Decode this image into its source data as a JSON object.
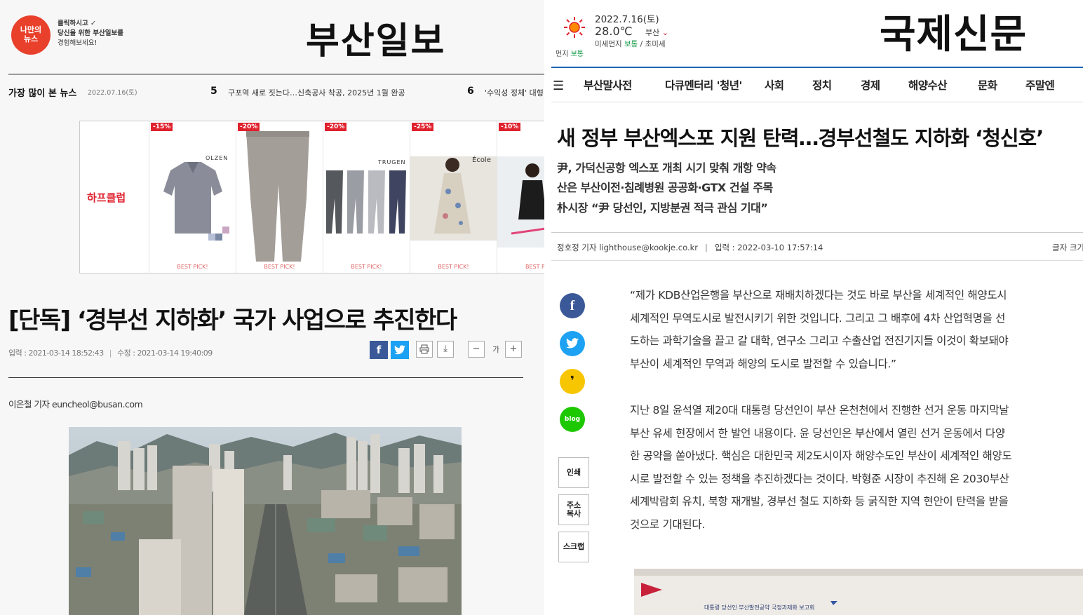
{
  "left": {
    "promo": {
      "circle_text": [
        "나만의",
        "뉴스"
      ],
      "lines": [
        "클릭하시고 ✓",
        "당신을 위한 부산일보를",
        "경험해보세요!"
      ]
    },
    "logo": "부산일보",
    "most_viewed": {
      "label": "가장 많이 본 뉴스",
      "date": "2022.07.16(토)",
      "items": [
        {
          "rank": "5",
          "title": "구포역 새로 짓는다…신축공사 착공, 2025년 1월 완공"
        },
        {
          "rank": "6",
          "title": "'수익성 정체' 대형"
        }
      ]
    },
    "ad": {
      "brand": "하프클럽",
      "items": [
        {
          "badge": "-15%",
          "label": "OLZEN",
          "pick": "BEST PICK!"
        },
        {
          "badge": "-20%",
          "label": "",
          "pick": "BEST PICK!"
        },
        {
          "badge": "-20%",
          "label": "TRUGEN",
          "pick": "BEST PICK!"
        },
        {
          "badge": "-25%",
          "label": "École",
          "pick": "BEST PICK!"
        },
        {
          "badge": "-10%",
          "label": "",
          "pick": "BEST P"
        }
      ]
    },
    "article": {
      "headline": "[단독] ‘경부선 지하화’ 국가 사업으로 추진한다",
      "input_time": "입력 : 2021-03-14 18:52:43",
      "modified_time": "수정 : 2021-03-14 19:40:09",
      "font_label": "가",
      "reporter": "이은철 기자 euncheol@busan.com"
    }
  },
  "right": {
    "weather": {
      "date": "2022.7.16(토)",
      "temp": "28.0℃",
      "city": "부산",
      "dust_label": "미세먼지",
      "dust_value": "보통",
      "dust_sep": "/ 초미세",
      "dust2_label": "먼지",
      "dust2_value": "보통"
    },
    "logo": "국제신문",
    "nav": [
      "부산말사전",
      "다큐멘터리 '청년'",
      "사회",
      "정치",
      "경제",
      "해양수산",
      "문화",
      "주말엔"
    ],
    "article": {
      "headline": "새 정부 부산엑스포 지원 탄력…경부선철도 지하화 ‘청신호’",
      "subs": [
        "尹, 가덕신공항 엑스포 개최 시기 맞춰 개항 약속",
        "산은 부산이전·침례병원 공공화·GTX 건설 주목",
        "朴시장 “尹 당선인, 지방분권 적극 관심 기대”"
      ],
      "reporter": "정호정 기자 lighthouse@kookje.co.kr",
      "input_time": "입력 : 2022-03-10 17:57:14",
      "font_size_label": "글자 크기",
      "para1": [
        "“제가 KDB산업은행을 부산으로 재배치하겠다는 것도 바로 부산을 세계적인 해양도시",
        "세계적인 무역도시로 발전시키기 위한 것입니다. 그리고 그 배후에 4차 산업혁명을 선",
        "도하는 과학기술을 끌고 갈 대학, 연구소 그리고 수출산업 전진기지들 이것이 확보돼야",
        "부산이 세계적인 무역과 해양의 도시로 발전할 수 있습니다.”"
      ],
      "para2": [
        "지난 8일 윤석열 제20대 대통령 당선인이 부산 온천천에서 진행한 선거 운동 마지막날",
        "부산 유세 현장에서 한 발언 내용이다. 윤 당선인은 부산에서 열린 선거 운동에서 다양",
        "한 공약을 쏟아냈다. 핵심은 대한민국 제2도시이자 해양수도인 부산이 세계적인 해양도",
        "시로 발전할 수 있는 정책을 추진하겠다는 것이다. 박형준 시장이 추진해 온 2030부산",
        "세계박람회 유치, 북항 재개발, 경부선 철도 지하화 등 굵직한 지역 현안이 탄력을 받을",
        "것으로 기대된다."
      ],
      "photo_caption": "대통령 당선인 부산발전공약 국정과제화 보고회"
    },
    "share": {
      "blog": "blog",
      "print": "인쇄",
      "copy_url": [
        "주소",
        "복사"
      ],
      "scrap": "스크랩"
    }
  },
  "colors": {
    "busan_red": "#e0212e",
    "kookje_blue": "#1d66b5",
    "facebook": "#3b5998",
    "twitter": "#1da1f2",
    "kakao": "#f7c600",
    "blog_green": "#1ec800"
  }
}
